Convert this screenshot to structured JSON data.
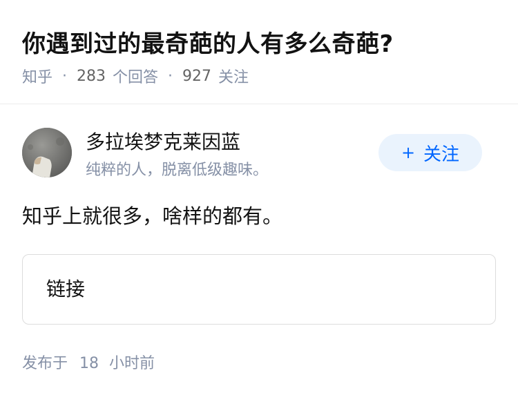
{
  "question": {
    "title": "你遇到过的最奇葩的人有多么奇葩?",
    "source": "知乎",
    "answer_count": "283",
    "answer_label": "个回答",
    "follow_count": "927",
    "follow_label": "关注",
    "separator": "·"
  },
  "author": {
    "name": "多拉埃梦克莱因蓝",
    "bio": "纯粹的人，脱离低级趣味。",
    "follow_button": "关注",
    "follow_button_prefix": "+"
  },
  "answer": {
    "text": "知乎上就很多，啥样的都有。",
    "link_card_label": "链接"
  },
  "footer": {
    "published_label": "发布于",
    "published_value": "18",
    "published_unit": "小时前"
  },
  "colors": {
    "title": "#121212",
    "meta": "#8590a6",
    "accent": "#0066ff",
    "follow_bg": "#eaf3fd"
  }
}
